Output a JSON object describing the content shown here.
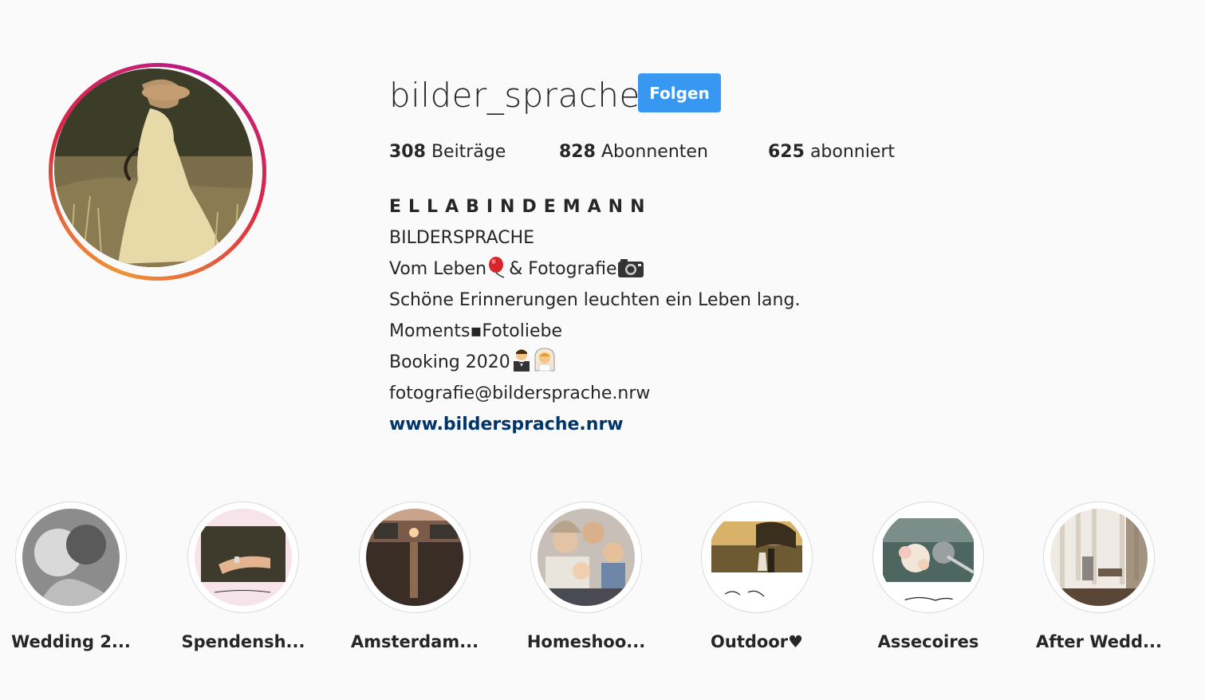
{
  "profile": {
    "username": "bilder_sprache",
    "follow_label": "Folgen",
    "stats": [
      {
        "count": "308",
        "label": "Beiträge"
      },
      {
        "count": "828",
        "label": "Abonnenten"
      },
      {
        "count": "625",
        "label": "abonniert"
      }
    ],
    "bio": {
      "full_name": "ELLABINDEMANN",
      "line1": "BILDERSPRACHE",
      "line2_a": "Vom Leben",
      "line2_b": "& Fotografie",
      "line3": "Schöne Erinnerungen leuchten ein Leben lang.",
      "line4": "Moments▪Fotoliebe",
      "line5": "Booking 2020",
      "line6": "fotografie@bildersprache.nrw",
      "website": "www.bildersprache.nrw"
    }
  },
  "highlights": [
    {
      "label": "Wedding 2..."
    },
    {
      "label": "Spendensh..."
    },
    {
      "label": "Amsterdam..."
    },
    {
      "label": "Homeshoo..."
    },
    {
      "label": "Outdoor♥"
    },
    {
      "label": "Assecoires"
    },
    {
      "label": "After Wedd..."
    }
  ],
  "colors": {
    "follow_button": "#3897f0",
    "link": "#003569",
    "ring_gradient": [
      "#f09433",
      "#dc2743",
      "#bc1888"
    ]
  }
}
